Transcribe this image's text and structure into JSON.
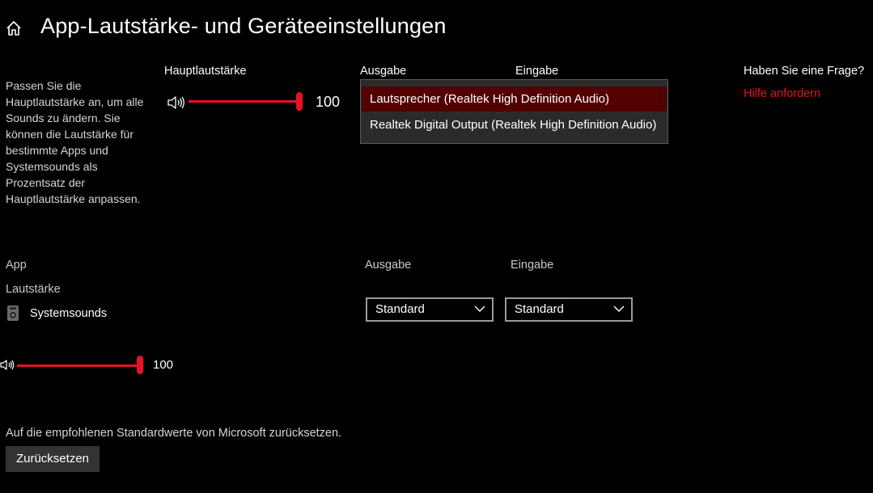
{
  "header": {
    "title": "App-Lautstärke- und Geräteeinstellungen"
  },
  "master": {
    "description": "Passen Sie die Hauptlautstärke an, um alle Sounds zu ändern. Sie können die Lautstärke für bestimmte Apps und Systemsounds als Prozentsatz der Hauptlautstärke anpassen.",
    "volume_label": "Hauptlautstärke",
    "volume_value": "100",
    "volume_level": 1.0,
    "output_label": "Ausgabe",
    "input_label": "Eingabe",
    "output_options": [
      "Lautsprecher (Realtek High Definition Audio)",
      "Realtek Digital Output (Realtek High Definition Audio)"
    ]
  },
  "help": {
    "question": "Haben Sie eine Frage?",
    "link": "Hilfe anfordern"
  },
  "apps": {
    "col_app": "App",
    "col_volume": "Lautstärke",
    "col_output": "Ausgabe",
    "col_input": "Eingabe",
    "rows": [
      {
        "name": "Systemsounds",
        "volume_value": "100",
        "volume_level": 1.0,
        "output": "Standard",
        "input": "Standard"
      }
    ]
  },
  "reset": {
    "text": "Auf die empfohlenen Standardwerte von Microsoft zurücksetzen.",
    "button": "Zurücksetzen"
  },
  "colors": {
    "accent": "#e81123",
    "selected_item": "#520000",
    "background": "#000000"
  }
}
